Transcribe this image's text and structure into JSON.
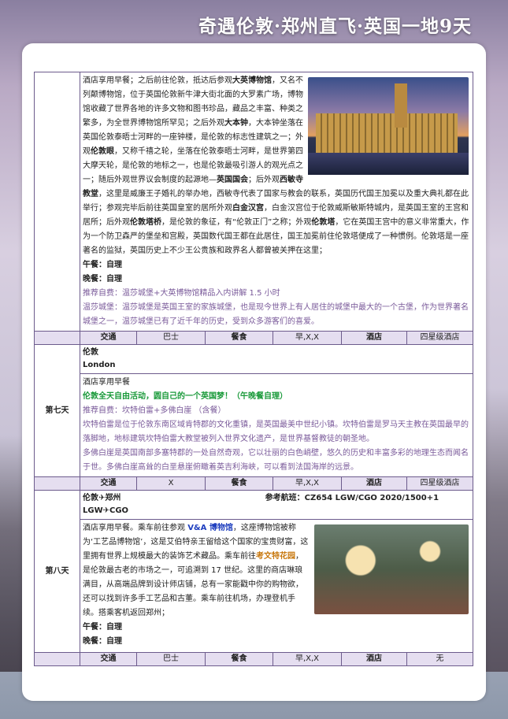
{
  "header": {
    "title": "奇遇伦敦·郑州直飞·英国一地9天"
  },
  "day6": {
    "p1a": "酒店享用早餐；之后前往伦敦，抵达后参观",
    "p1b": "大英博物馆",
    "p1c": "，又名不列颠博物馆，位于英国伦敦新牛津大街北面的大罗素广场，博物馆收藏了世界各地的许多文物和图书珍品，藏品之丰富、种类之繁多，为全世界博物馆所罕见；之后外观",
    "p1d": "大本钟",
    "p1e": "，大本钟坐落在英国伦敦泰晤士河畔的一座钟楼，是伦敦的标志性建筑之一；外观",
    "p1f": "伦敦眼",
    "p1g": "，又称千禧之轮，坐落在伦敦泰晤士河畔，是世界第四大摩天轮，是伦敦的地标之一，也是伦敦最吸引游人的观光点之一；随后外观世界议会制度的起源地—",
    "p1h": "英国国会",
    "p1i": "；后外观",
    "p1j": "西敏寺教堂",
    "p1k": "，这里是威廉王子婚礼的举办地，西敏寺代表了国家与教会的联系，英国历代国王加冕以及重大典礼都在此举行；参观完毕后前往英国皇室的居所外观",
    "p1l": "白金汉宫",
    "p1m": "，白金汉宫位于伦敦威斯敏斯特城内，是英国王室的王宫和居所；后外观",
    "p1n": "伦敦塔桥",
    "p1o": "，是伦敦的象征，有“伦敦正门”之称；外观",
    "p1p": "伦敦塔",
    "p1q": "，它在英国王宫中的意义非常重大，作为一个防卫森严的堡垒和宫殿，英国数代国王都在此居住，国王加冕前住伦敦塔便成了一种惯例。伦敦塔是一座著名的监狱，英国历史上不少王公贵族和政界名人都曾被关押在这里；",
    "lunch": "午餐：自理",
    "dinner": "晚餐：自理",
    "rec1": "推荐自费：温莎城堡+大英博物馆精品入内讲解 1.5 小时",
    "rec2": "温莎城堡：温莎城堡是英国王室的家族城堡，也是现今世界上有人居住的城堡中最大的一个古堡，作为世界著名城堡之一，温莎城堡已有了近千年的历史，受到众多游客们的喜爱。",
    "info": {
      "transport_k": "交通",
      "transport_v": "巴士",
      "meal_k": "餐食",
      "meal_v": "早,X,X",
      "hotel_k": "酒店",
      "hotel_v": "四星级酒店"
    }
  },
  "day7": {
    "label": "第七天",
    "city_cn": "伦敦",
    "city_en": "London",
    "p1": "酒店享用早餐",
    "free": "伦敦全天自由活动，圆自己的一个英国梦！（午晚餐自理）",
    "rec": "推荐自费：坎特伯雷+多佛白崖 （含餐）",
    "d1": "坎特伯雷是位于伦敦东南区域肯特郡的文化重镇，是英国最美中世纪小镇。坎特伯雷是罗马天主教在英国最早的落脚地，地标建筑坎特伯雷大教堂被列入世界文化遗产，是世界基督教徒的朝圣地。",
    "d2": "多佛白崖是英国南部多塞特郡的一处自然奇观，它以壮丽的白色峭壁，悠久的历史和丰富多彩的地理生态而闻名于世。多佛白崖高耸的白垩悬崖俯瞰着英吉利海峡，可以看到法国海岸的远景。",
    "info": {
      "transport_k": "交通",
      "transport_v": "X",
      "meal_k": "餐食",
      "meal_v": "早,X,X",
      "hotel_k": "酒店",
      "hotel_v": "四星级酒店"
    }
  },
  "day8": {
    "label": "第八天",
    "route": "伦敦✈郑州",
    "flight": "参考航班：CZ654 LGW/CGO 2020/1500+1",
    "route2": "LGW✈CGO",
    "p1a": "酒店享用早餐。乘车前往参观 ",
    "p1b": "V&A 博物馆",
    "p1c": "，这座博物馆被称为‘工艺品博物馆’，这是艾伯特亲王留给这个国家的宝贵财富，这里拥有世界上规模最大的装饰艺术藏品。乘车前往",
    "p1d": "考文特花园",
    "p1e": "，是伦敦最古老的市场之一，可追溯到 17 世纪。这里的商店琳琅满目，从高端品牌到设计师店铺，总有一家能戳中你的购物欲，还可以找到许多手工艺品和古董。乘车前往机场，办理登机手续。搭乘客机返回郑州；",
    "lunch": "午餐：自理",
    "dinner": "晚餐：自理",
    "info": {
      "transport_k": "交通",
      "transport_v": "巴士",
      "meal_k": "餐食",
      "meal_v": "早,X,X",
      "hotel_k": "酒店",
      "hotel_v": "无"
    }
  }
}
